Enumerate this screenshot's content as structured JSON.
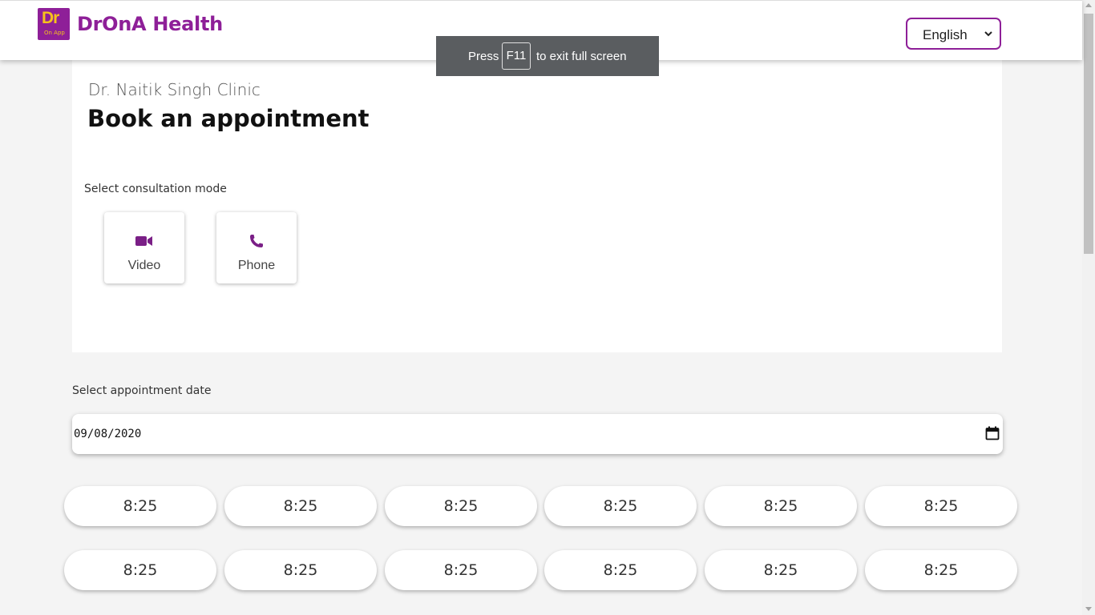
{
  "header": {
    "logo_main": "Dr",
    "logo_sub": "On App",
    "brand": "DrOnA Health",
    "language_selected": "English"
  },
  "fullscreen_toast": {
    "prefix": "Press",
    "key": "F11",
    "suffix": "to exit full screen"
  },
  "clinic_name": "Dr. Naitik Singh Clinic",
  "page_title": "Book an appointment",
  "consultation": {
    "label": "Select consultation mode",
    "modes": [
      {
        "label": "Video",
        "icon": "video-camera-icon"
      },
      {
        "label": "Phone",
        "icon": "phone-icon"
      }
    ]
  },
  "date": {
    "label": "Select appointment date",
    "value": "09/08/2020"
  },
  "slots": [
    [
      "8:25",
      "8:25",
      "8:25",
      "8:25",
      "8:25",
      "8:25"
    ],
    [
      "8:25",
      "8:25",
      "8:25",
      "8:25",
      "8:25",
      "8:25"
    ]
  ],
  "colors": {
    "brand": "#8e1f98",
    "logo_text": "#f6c21c",
    "toast_bg": "#5a5d60"
  }
}
